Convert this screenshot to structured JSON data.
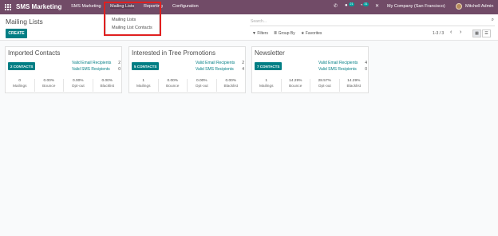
{
  "topbar": {
    "app_name": "SMS Marketing",
    "menus": [
      "SMS Marketing",
      "Mailing Lists",
      "Reporting",
      "Configuration"
    ],
    "messages_badge": "21",
    "activities_badge": "31",
    "company": "My Company (San Francisco)",
    "user": "Mitchell Admin"
  },
  "dropdown": {
    "items": [
      "Mailing Lists",
      "Mailing List Contacts"
    ]
  },
  "control": {
    "title": "Mailing Lists",
    "create_label": "CREATE",
    "search_placeholder": "Search...",
    "filters_label": "Filters",
    "groupby_label": "Group By",
    "favorites_label": "Favorites",
    "pager": "1-3 / 3"
  },
  "cards": [
    {
      "title": "Imported Contacts",
      "contacts_label": "2 CONTACTS",
      "valid_email_label": "Valid Email Recipients",
      "valid_email": "2",
      "valid_sms_label": "Valid SMS Recipients",
      "valid_sms": "0",
      "stats": [
        {
          "value": "0",
          "label": "Mailings"
        },
        {
          "value": "0.00%",
          "label": "Bounce"
        },
        {
          "value": "0.00%",
          "label": "Opt-out"
        },
        {
          "value": "0.00%",
          "label": "Blacklist"
        }
      ]
    },
    {
      "title": "Interested in Tree Promotions",
      "contacts_label": "5 CONTACTS",
      "valid_email_label": "Valid Email Recipients",
      "valid_email": "2",
      "valid_sms_label": "Valid SMS Recipients",
      "valid_sms": "4",
      "stats": [
        {
          "value": "1",
          "label": "Mailings"
        },
        {
          "value": "0.00%",
          "label": "Bounce"
        },
        {
          "value": "0.00%",
          "label": "Opt-out"
        },
        {
          "value": "0.00%",
          "label": "Blacklist"
        }
      ]
    },
    {
      "title": "Newsletter",
      "contacts_label": "7 CONTACTS",
      "valid_email_label": "Valid Email Recipients",
      "valid_email": "4",
      "valid_sms_label": "Valid SMS Recipients",
      "valid_sms": "0",
      "stats": [
        {
          "value": "1",
          "label": "Mailings"
        },
        {
          "value": "14.29%",
          "label": "Bounce"
        },
        {
          "value": "28.57%",
          "label": "Opt-out"
        },
        {
          "value": "14.29%",
          "label": "Blacklist"
        }
      ]
    }
  ],
  "colors": {
    "brand": "#714b67",
    "accent": "#017e84",
    "highlight": "#e02020"
  }
}
